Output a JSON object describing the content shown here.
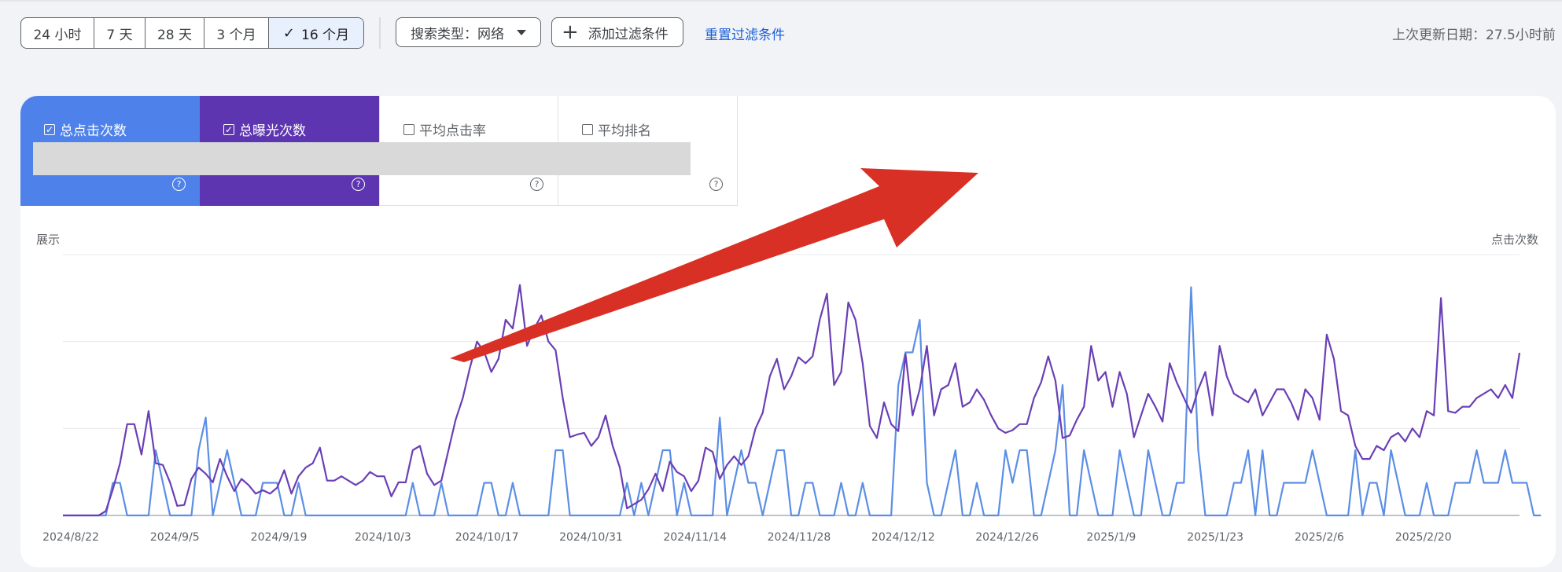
{
  "toolbar": {
    "ranges": [
      "24 小时",
      "7 天",
      "28 天",
      "3 个月",
      "16 个月"
    ],
    "active_range": "16 个月",
    "search_type": "搜索类型：网络",
    "add_filter": "添加过滤条件",
    "reset_filters": "重置过滤条件",
    "last_update": "上次更新日期：27.5小时前"
  },
  "metrics": [
    {
      "label": "总点击次数",
      "checked": true,
      "color": "#4e82ea"
    },
    {
      "label": "总曝光次数",
      "checked": true,
      "color": "#5e35b1"
    },
    {
      "label": "平均点击率",
      "checked": false
    },
    {
      "label": "平均排名",
      "checked": false
    }
  ],
  "colors": {
    "clicks": "#5b8ee6",
    "impressions": "#6a3fb5",
    "annotation_arrow": "#d93025",
    "redaction": "#d9d9d9"
  },
  "chart_data": {
    "type": "line",
    "left_axis_label": "展示",
    "right_axis_label": "点击次数",
    "x_tick_labels": [
      "2024/8/22",
      "2024/9/5",
      "2024/9/19",
      "2024/10/3",
      "2024/10/17",
      "2024/10/31",
      "2024/11/14",
      "2024/11/28",
      "2024/12/12",
      "2024/12/26",
      "2025/1/9",
      "2025/1/23",
      "2025/2/6",
      "2025/2/20"
    ],
    "x_start": "2024/8/22",
    "x_end": "2025/3/6",
    "grid": true,
    "y_scale": "relative, values hidden",
    "series": [
      {
        "name": "总曝光次数",
        "axis": "left",
        "values": [
          0,
          0,
          0,
          0,
          0,
          0,
          0.5,
          3,
          6,
          10.5,
          10.5,
          7,
          12,
          6,
          5.8,
          3.8,
          1.1,
          1.2,
          4.2,
          5.5,
          4.8,
          3.8,
          6.5,
          4.5,
          2.8,
          4.2,
          3.5,
          2.5,
          2.9,
          2.5,
          3.2,
          5.2,
          2.5,
          4.5,
          5.5,
          6,
          7.8,
          4,
          4,
          4.5,
          4,
          3.5,
          4,
          5,
          4.5,
          4.5,
          2.2,
          3.8,
          3.8,
          7.5,
          8,
          4.8,
          3.5,
          4,
          7.5,
          11,
          13.5,
          17,
          20,
          18.8,
          16.5,
          18,
          22.5,
          21.5,
          26.5,
          19.5,
          21.5,
          23,
          20,
          19,
          13.5,
          9,
          9.3,
          9.5,
          8,
          9,
          11.5,
          8,
          5.5,
          0.8,
          1.3,
          1.8,
          3,
          4.8,
          2.8,
          6.2,
          5,
          4.5,
          2.8,
          4,
          7.8,
          7.3,
          4.2,
          5.8,
          6.8,
          5.8,
          6.8,
          10,
          11.8,
          16,
          18,
          14.5,
          16,
          18.2,
          17.5,
          18.3,
          22.5,
          25.5,
          15,
          16.5,
          24.5,
          22.5,
          17.5,
          10.3,
          8.9,
          13,
          10.5,
          9.7,
          18.6,
          11.5,
          14.5,
          19.5,
          11.5,
          14.5,
          15,
          17.5,
          12.5,
          13,
          14.5,
          13.3,
          11.5,
          10,
          9.5,
          9.8,
          10.5,
          10.5,
          13.5,
          15.3,
          18.3,
          15.5,
          8.9,
          9.2,
          11,
          12.5,
          19.5,
          15.5,
          16.5,
          12.5,
          16.5,
          14,
          9,
          11.5,
          14,
          12.5,
          10.8,
          17.5,
          15.3,
          13.5,
          11.8,
          14.5,
          16.5,
          11.5,
          19.5,
          16,
          14,
          13.5,
          13,
          14.5,
          11.5,
          13,
          14.5,
          14.5,
          13,
          11,
          14.5,
          13.5,
          11,
          20.8,
          18,
          12,
          11.5,
          8,
          6.5,
          6.5,
          8,
          7.5,
          9,
          9.5,
          8.5,
          10,
          9,
          12,
          11.5,
          25,
          12,
          11.8,
          12.5,
          12.5,
          13.5,
          14,
          14.5,
          13.5,
          15,
          13.5,
          18.7
        ],
        "color": "#6a3fb5"
      },
      {
        "name": "总点击次数",
        "axis": "right",
        "values": [
          0,
          0,
          0,
          0,
          0,
          0,
          0,
          1,
          1,
          0,
          0,
          0,
          0,
          2,
          1,
          0,
          0,
          0,
          0,
          2,
          3,
          0,
          1,
          2,
          1,
          0,
          0,
          0,
          1,
          1,
          1,
          0,
          0,
          1,
          0,
          0,
          0,
          0,
          0,
          0,
          0,
          0,
          0,
          0,
          0,
          0,
          0,
          0,
          0,
          1,
          0,
          0,
          0,
          1,
          0,
          0,
          0,
          0,
          0,
          1,
          1,
          0,
          0,
          1,
          0,
          0,
          0,
          0,
          0,
          2,
          2,
          0,
          0,
          0,
          0,
          0,
          0,
          0,
          0,
          1,
          0,
          1,
          0,
          1,
          2,
          2,
          0,
          1,
          0,
          0,
          0,
          0,
          3,
          0,
          1,
          2,
          1,
          1,
          0,
          1,
          2,
          2,
          0,
          0,
          1,
          1,
          0,
          0,
          0,
          1,
          0,
          0,
          1,
          0,
          0,
          0,
          0,
          4,
          5,
          5,
          6,
          1,
          0,
          0,
          1,
          2,
          0,
          0,
          1,
          0,
          0,
          0,
          2,
          1,
          2,
          2,
          0,
          0,
          1,
          2,
          4,
          0,
          0,
          2,
          1,
          0,
          0,
          0,
          2,
          1,
          0,
          0,
          2,
          1,
          0,
          0,
          1,
          1,
          7,
          2,
          0,
          0,
          0,
          0,
          1,
          1,
          2,
          0,
          2,
          0,
          0,
          1,
          1,
          1,
          1,
          2,
          1,
          0,
          0,
          0,
          0,
          2,
          0,
          1,
          1,
          0,
          2,
          1,
          0,
          0,
          0,
          1,
          0,
          0,
          0,
          1,
          1,
          1,
          2,
          1,
          1,
          1,
          2,
          1,
          1,
          1,
          0,
          0
        ]
      }
    ]
  },
  "icons": {
    "check": "check-icon",
    "caret": "caret-down-icon",
    "plus": "plus-icon",
    "help": "help-circle-icon"
  }
}
